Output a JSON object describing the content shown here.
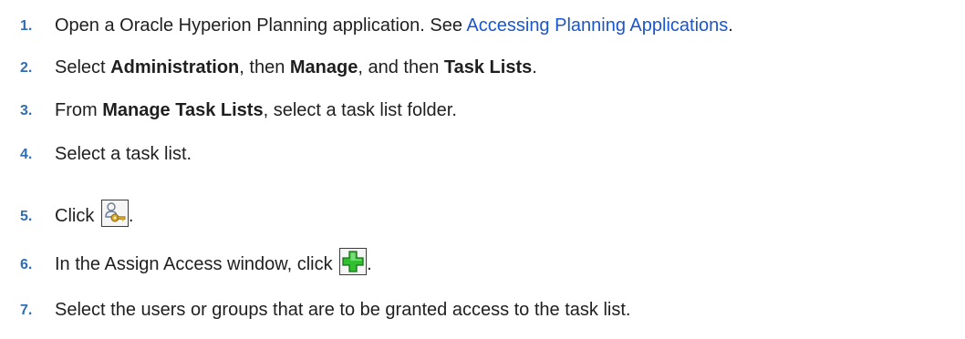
{
  "steps": [
    {
      "number": "1.",
      "text_before": "Open a Oracle Hyperion Planning application. See ",
      "link": "Accessing Planning Applications",
      "text_after": "."
    },
    {
      "number": "2.",
      "t1": "Select ",
      "b1": "Administration",
      "t2": ", then ",
      "b2": "Manage",
      "t3": ", and then ",
      "b3": "Task Lists",
      "t4": "."
    },
    {
      "number": "3.",
      "t1": "From ",
      "b1": "Manage Task Lists",
      "t2": ", select a task list folder."
    },
    {
      "number": "4.",
      "text": "Select a task list."
    },
    {
      "number": "5.",
      "text_before": "Click ",
      "icon": "assign-access-key-user-icon",
      "text_after": "."
    },
    {
      "number": "6.",
      "text_before": "In the Assign Access window, click ",
      "icon": "add-plus-icon",
      "text_after": "."
    },
    {
      "number": "7.",
      "text": "Select the users or groups that are to be granted access to the task list."
    }
  ]
}
